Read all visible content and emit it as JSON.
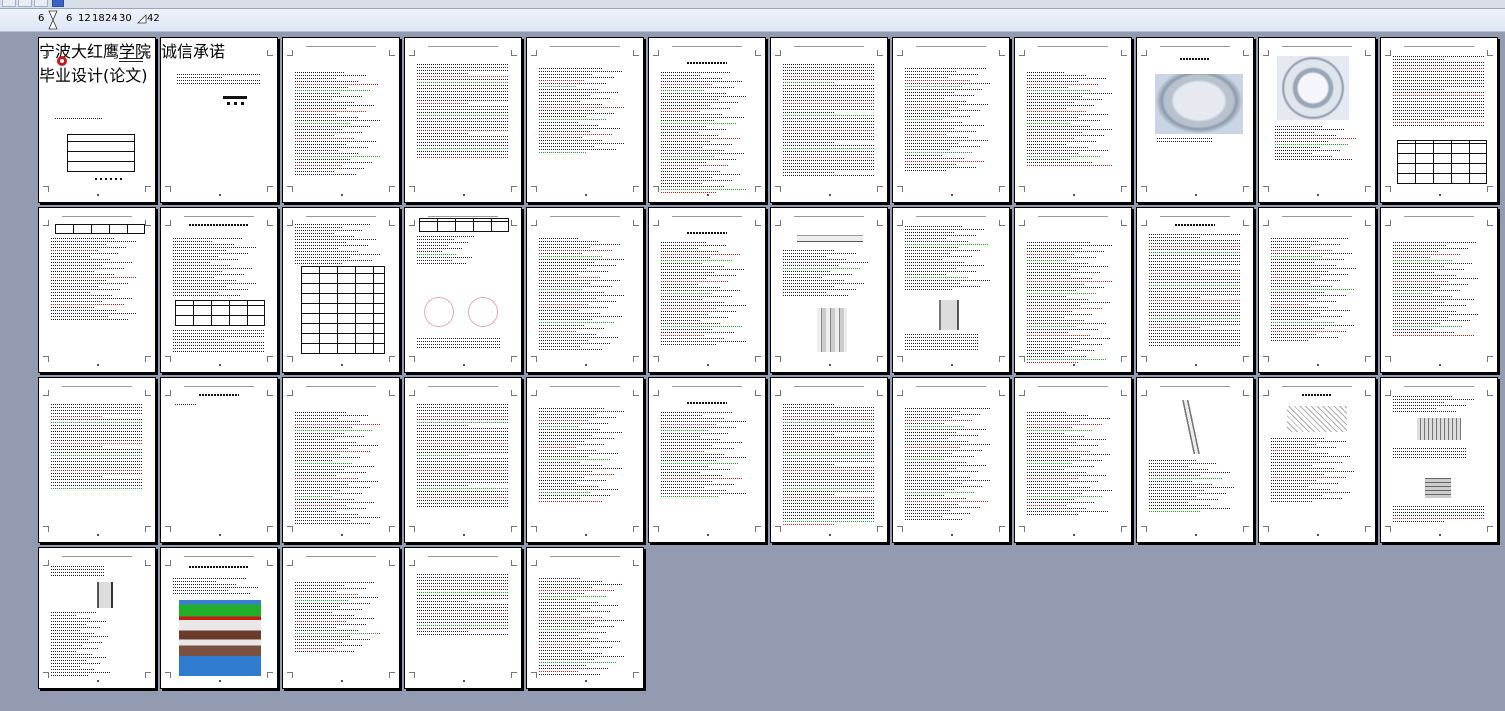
{
  "zoom_bar": {
    "current_start": "6",
    "steps": [
      "6",
      "12",
      "18",
      "24",
      "30"
    ],
    "end": "42"
  },
  "document": {
    "cover_title": "宁波大红鹰学院",
    "cover_subtitle": "毕业设计(论文)",
    "page2_title": "诚信承诺"
  },
  "colors": {
    "background": "#929bb0",
    "accent": "#3a62c6",
    "page": "#ffffff"
  }
}
